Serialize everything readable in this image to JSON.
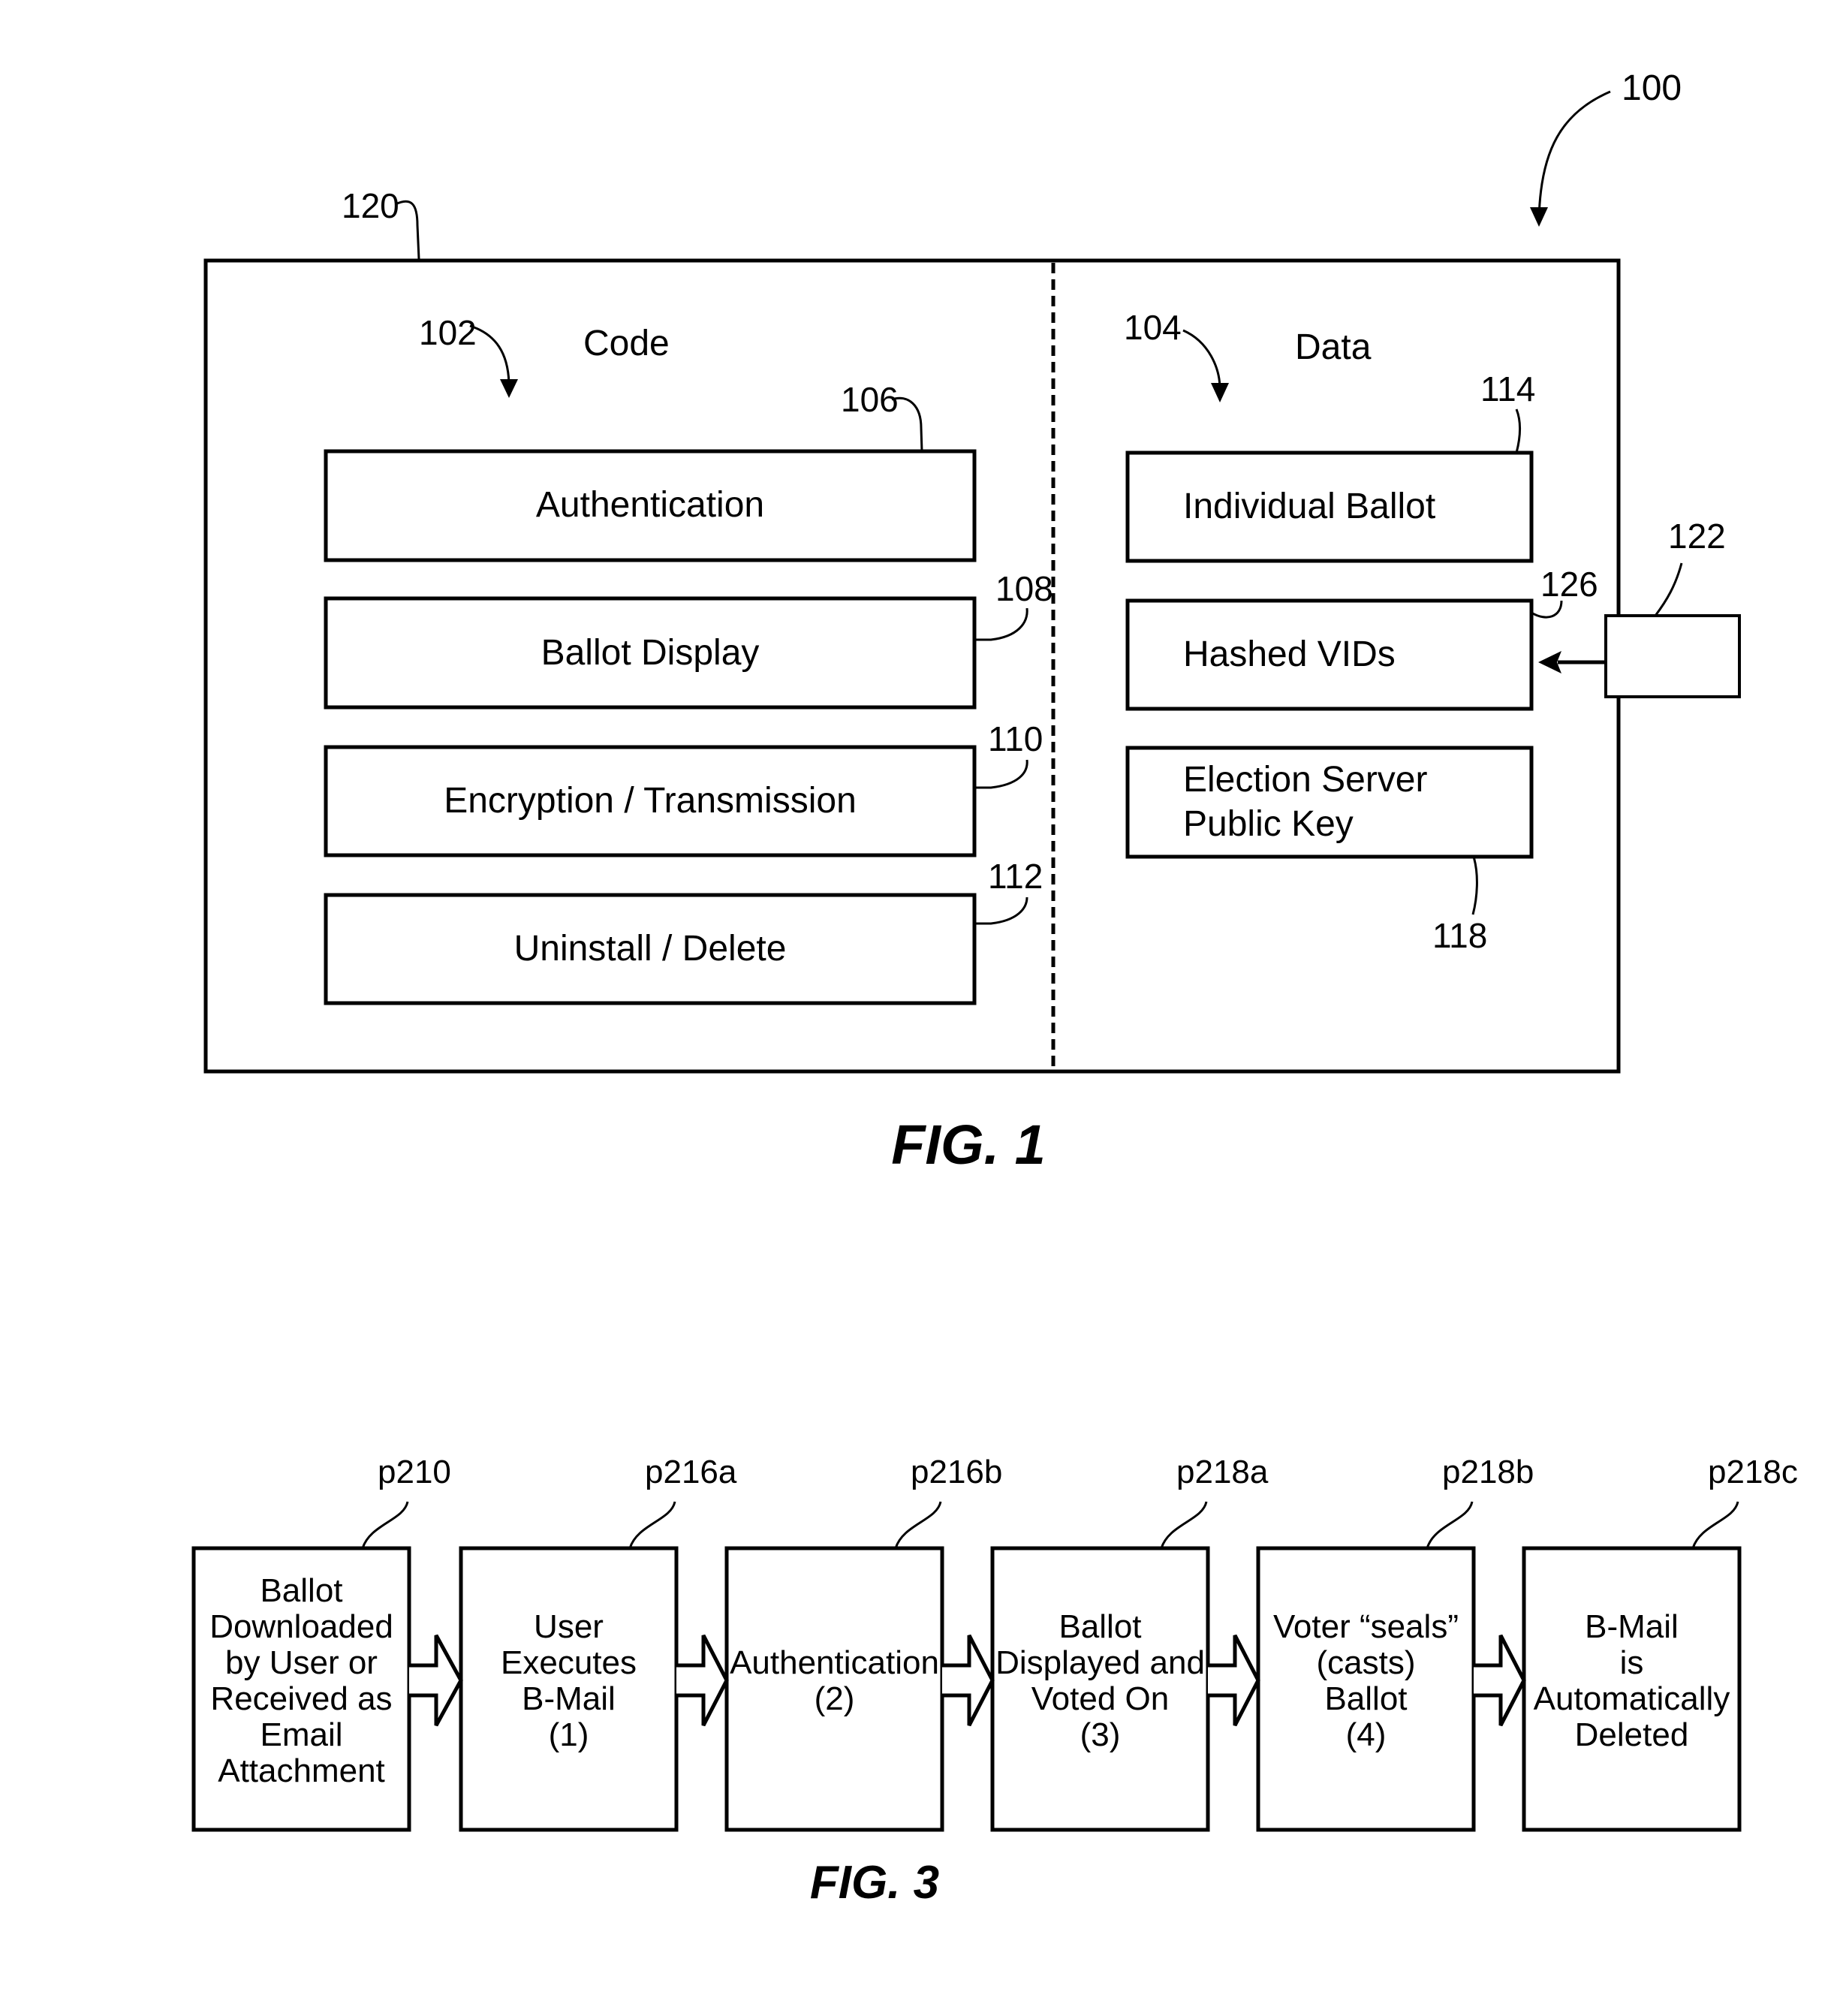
{
  "fig1": {
    "caption": "FIG. 1",
    "system_ref": "100",
    "container_ref": "120",
    "code_section": {
      "ref": "102",
      "title": "Code",
      "modules": [
        {
          "ref": "106",
          "label": "Authentication"
        },
        {
          "ref": "108",
          "label": "Ballot Display"
        },
        {
          "ref": "110",
          "label": "Encryption / Transmission"
        },
        {
          "ref": "112",
          "label": "Uninstall / Delete"
        }
      ]
    },
    "data_section": {
      "ref": "104",
      "title": "Data",
      "items": [
        {
          "ref": "114",
          "lines": [
            "Individual Ballot"
          ]
        },
        {
          "ref": "126",
          "lines": [
            "Hashed VIDs"
          ]
        },
        {
          "ref": "118",
          "lines": [
            "Election Server",
            "Public Key"
          ]
        }
      ]
    },
    "external_input": {
      "ref": "122",
      "label": "",
      "feeds": "Hashed VIDs"
    }
  },
  "fig3": {
    "caption": "FIG. 3",
    "steps": [
      {
        "ref": "p210",
        "lines": [
          "Ballot",
          "Downloaded",
          "by User or",
          "Received as",
          "Email",
          "Attachment"
        ]
      },
      {
        "ref": "p216a",
        "lines": [
          "User",
          "Executes",
          "B-Mail",
          "(1)"
        ]
      },
      {
        "ref": "p216b",
        "lines": [
          "Authentication",
          "(2)"
        ]
      },
      {
        "ref": "p218a",
        "lines": [
          "Ballot",
          "Displayed and",
          "Voted On",
          "(3)"
        ]
      },
      {
        "ref": "p218b",
        "lines": [
          "Voter “seals”",
          "(casts)",
          "Ballot",
          "(4)"
        ]
      },
      {
        "ref": "p218c",
        "lines": [
          "B-Mail",
          "is",
          "Automatically",
          "Deleted"
        ]
      }
    ]
  }
}
